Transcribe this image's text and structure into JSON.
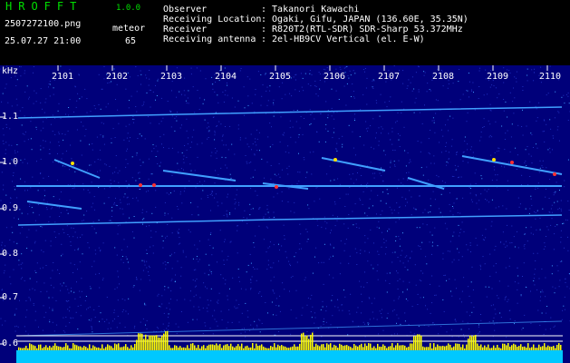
{
  "header": {
    "app_name": "HROFFT",
    "app_version": "1.0.0",
    "filename": "2507272100.png",
    "datetime": "25.07.27 21:00",
    "meteor_label": "meteor",
    "meteor_count": "65",
    "info": [
      {
        "key": "Observer",
        "value": ": Takanori Kawachi"
      },
      {
        "key": "Receiving Location",
        "value": ": Ogaki, Gifu, JAPAN (136.60E, 35.35N)"
      },
      {
        "key": "Receiver",
        "value": ": R820T2(RTL-SDR) SDR-Sharp 53.372MHz"
      },
      {
        "key": "Receiving antenna",
        "value": ": 2el-HB9CV Vertical (el. E-W)"
      }
    ]
  },
  "spectrogram": {
    "y_unit": "kHz",
    "y_ticks": [
      "1.1",
      "1.0",
      "0.9",
      "0.8",
      "0.7",
      "0.6"
    ],
    "x_ticks": [
      "2101",
      "2102",
      "2103",
      "2104",
      "2105",
      "2106",
      "2107",
      "2108",
      "2109",
      "2110"
    ],
    "colors": {
      "background": "#00007a",
      "noise": "#2030c0",
      "trace": "#40a0ff",
      "hot": "#ff3030",
      "warm": "#ffe000",
      "bar": "#00c8ff",
      "peak": "#ffff00"
    }
  }
}
